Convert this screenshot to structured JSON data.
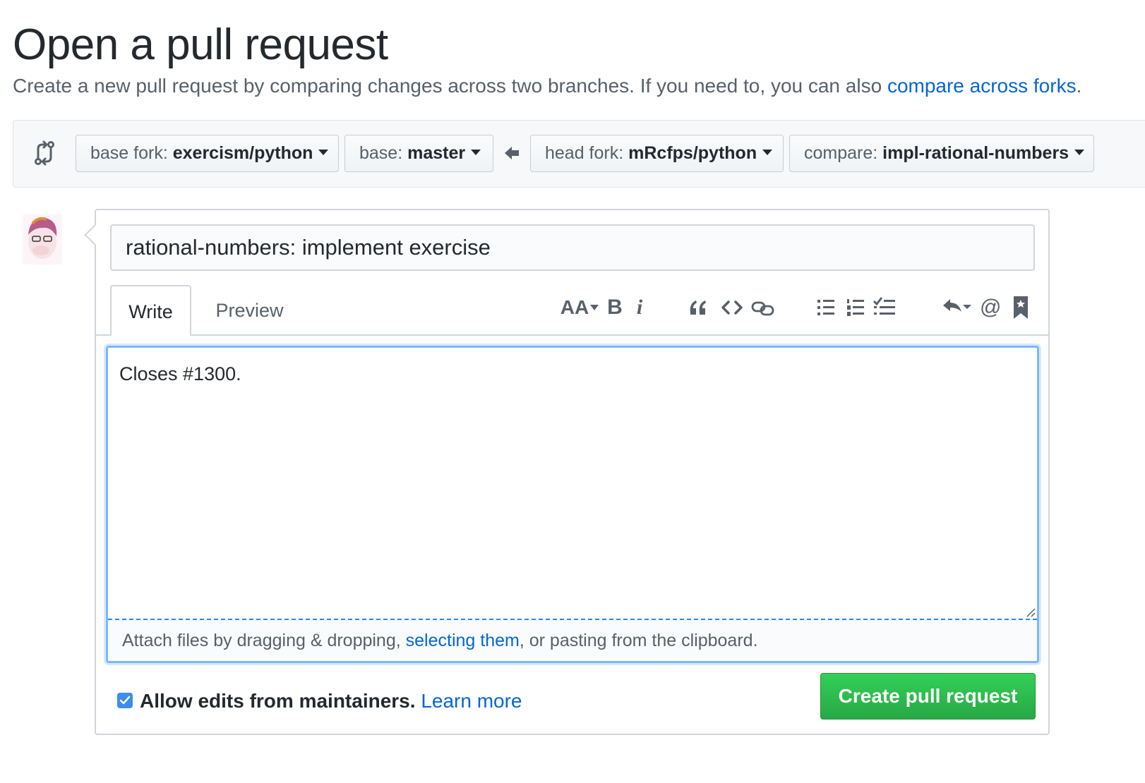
{
  "page": {
    "title": "Open a pull request",
    "subtitle_text": "Create a new pull request by comparing changes across two branches. If you need to, you can also ",
    "subtitle_link": "compare across forks",
    "subtitle_end": "."
  },
  "range": {
    "base_fork_label": "base fork: ",
    "base_fork_value": "exercism/python",
    "base_label": "base: ",
    "base_value": "master",
    "head_fork_label": "head fork: ",
    "head_fork_value": "mRcfps/python",
    "compare_label": "compare: ",
    "compare_value": "impl-rational-numbers"
  },
  "form": {
    "pr_title": "rational-numbers: implement exercise",
    "tabs": [
      "Write",
      "Preview"
    ],
    "body": "Closes #1300.",
    "attach_prefix": "Attach files by dragging & dropping, ",
    "attach_link": "selecting them",
    "attach_suffix": ", or pasting from the clipboard.",
    "allow_edits_label": "Allow edits from maintainers.",
    "learn_more": "Learn more",
    "allow_edits_checked": true,
    "submit_label": "Create pull request"
  },
  "toolbar": {
    "heading": "AA",
    "bold": "B",
    "italic": "i",
    "quote": "“",
    "mention": "@"
  },
  "colors": {
    "link": "#0366d6",
    "primary_button": "#28a745",
    "focus_border": "#79b8ff"
  }
}
